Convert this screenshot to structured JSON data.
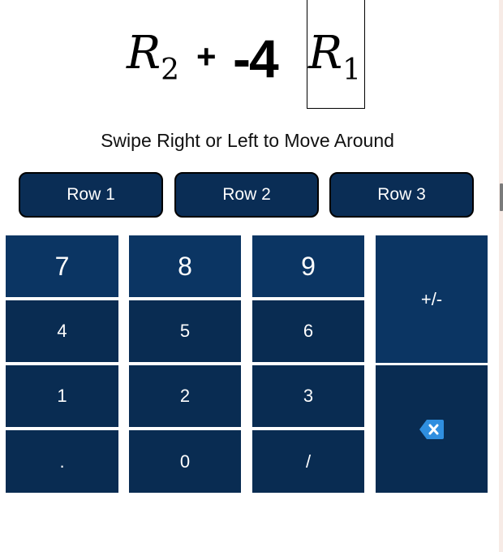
{
  "expression": {
    "left_var": "R",
    "left_sub": "2",
    "operator": "+",
    "coefficient": "-4",
    "right_var": "R",
    "right_sub": "1"
  },
  "hint": "Swipe Right or Left to Move Around",
  "row_buttons": [
    "Row 1",
    "Row 2",
    "Row 3"
  ],
  "keypad": {
    "k7": "7",
    "k8": "8",
    "k9": "9",
    "sign": "+/-",
    "k4": "4",
    "k5": "5",
    "k6": "6",
    "k1": "1",
    "k2": "2",
    "k3": "3",
    "decimal": ".",
    "k0": "0",
    "slash": "/",
    "backspace_icon": "backspace-icon"
  },
  "colors": {
    "key": "#0b3563",
    "row_button": "#0a2d55",
    "key_text": "#ffffff",
    "backspace_icon": "#2f8fe0"
  }
}
